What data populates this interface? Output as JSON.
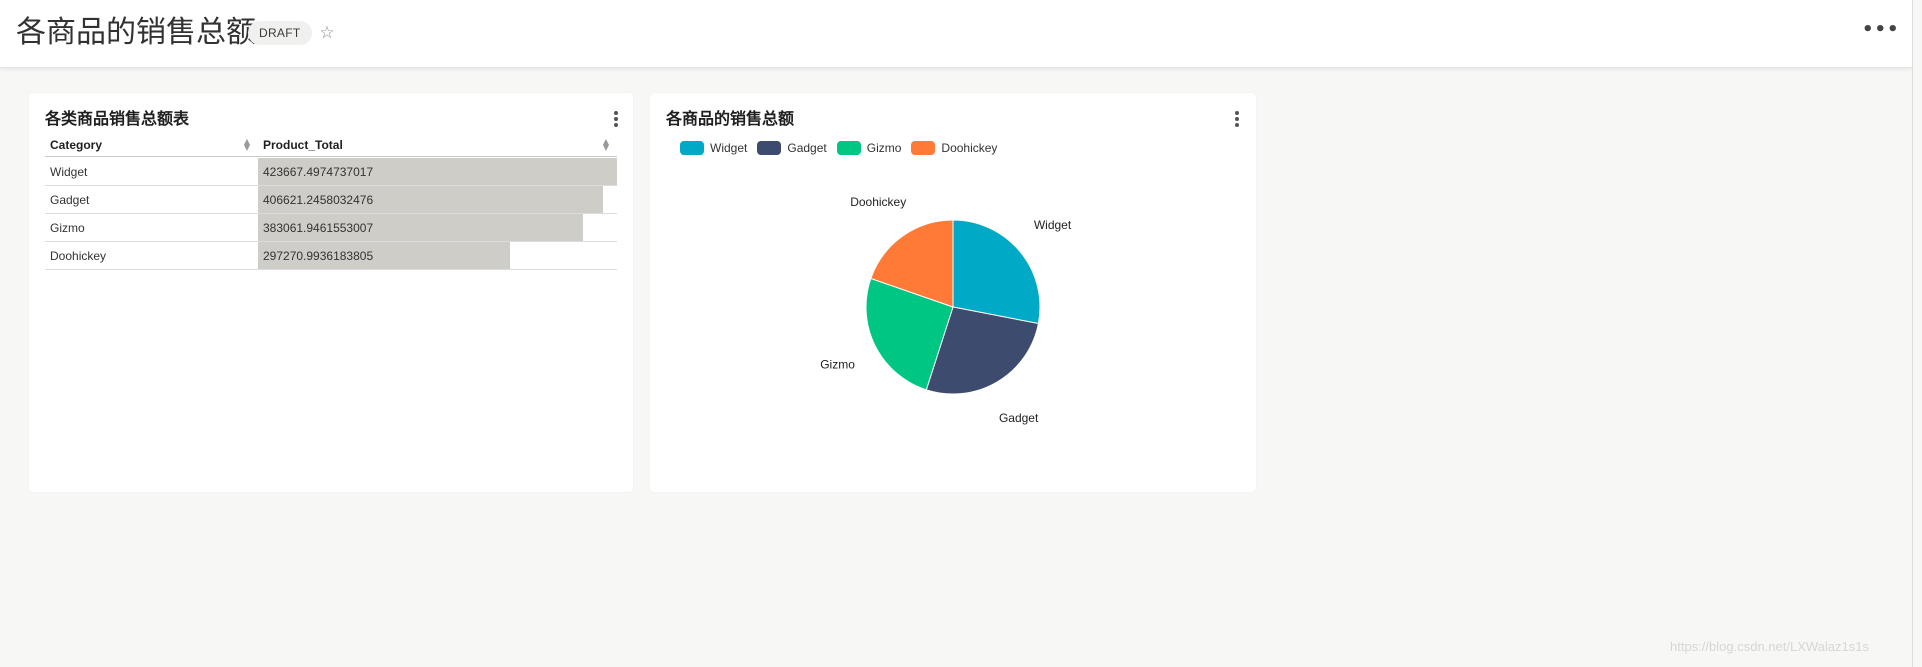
{
  "header": {
    "title": "各商品的销售总额",
    "badge": "DRAFT",
    "star_icon": "star-outline-icon",
    "more_icon": "more-horizontal-icon"
  },
  "table_card": {
    "title": "各类商品销售总额表",
    "columns": [
      "Category",
      "Product_Total"
    ],
    "rows": [
      {
        "category": "Widget",
        "total": "423667.4974737017",
        "value": 423667.4974737017
      },
      {
        "category": "Gadget",
        "total": "406621.2458032476",
        "value": 406621.2458032476
      },
      {
        "category": "Gizmo",
        "total": "383061.9461553007",
        "value": 383061.9461553007
      },
      {
        "category": "Doohickey",
        "total": "297270.9936183805",
        "value": 297270.9936183805
      }
    ],
    "bar_color": "#cfcdc7"
  },
  "chart_card": {
    "title": "各商品的销售总额"
  },
  "chart_data": {
    "type": "pie",
    "title": "各商品的销售总额",
    "categories": [
      "Widget",
      "Gadget",
      "Gizmo",
      "Doohickey"
    ],
    "values": [
      423667.4974737017,
      406621.2458032476,
      383061.9461553007,
      297270.9936183805
    ],
    "colors": [
      "#00a9c6",
      "#3d4b6e",
      "#00c684",
      "#ff7a36"
    ],
    "legend": "top-left"
  },
  "watermark": "https://blog.csdn.net/LXWalaz1s1s"
}
